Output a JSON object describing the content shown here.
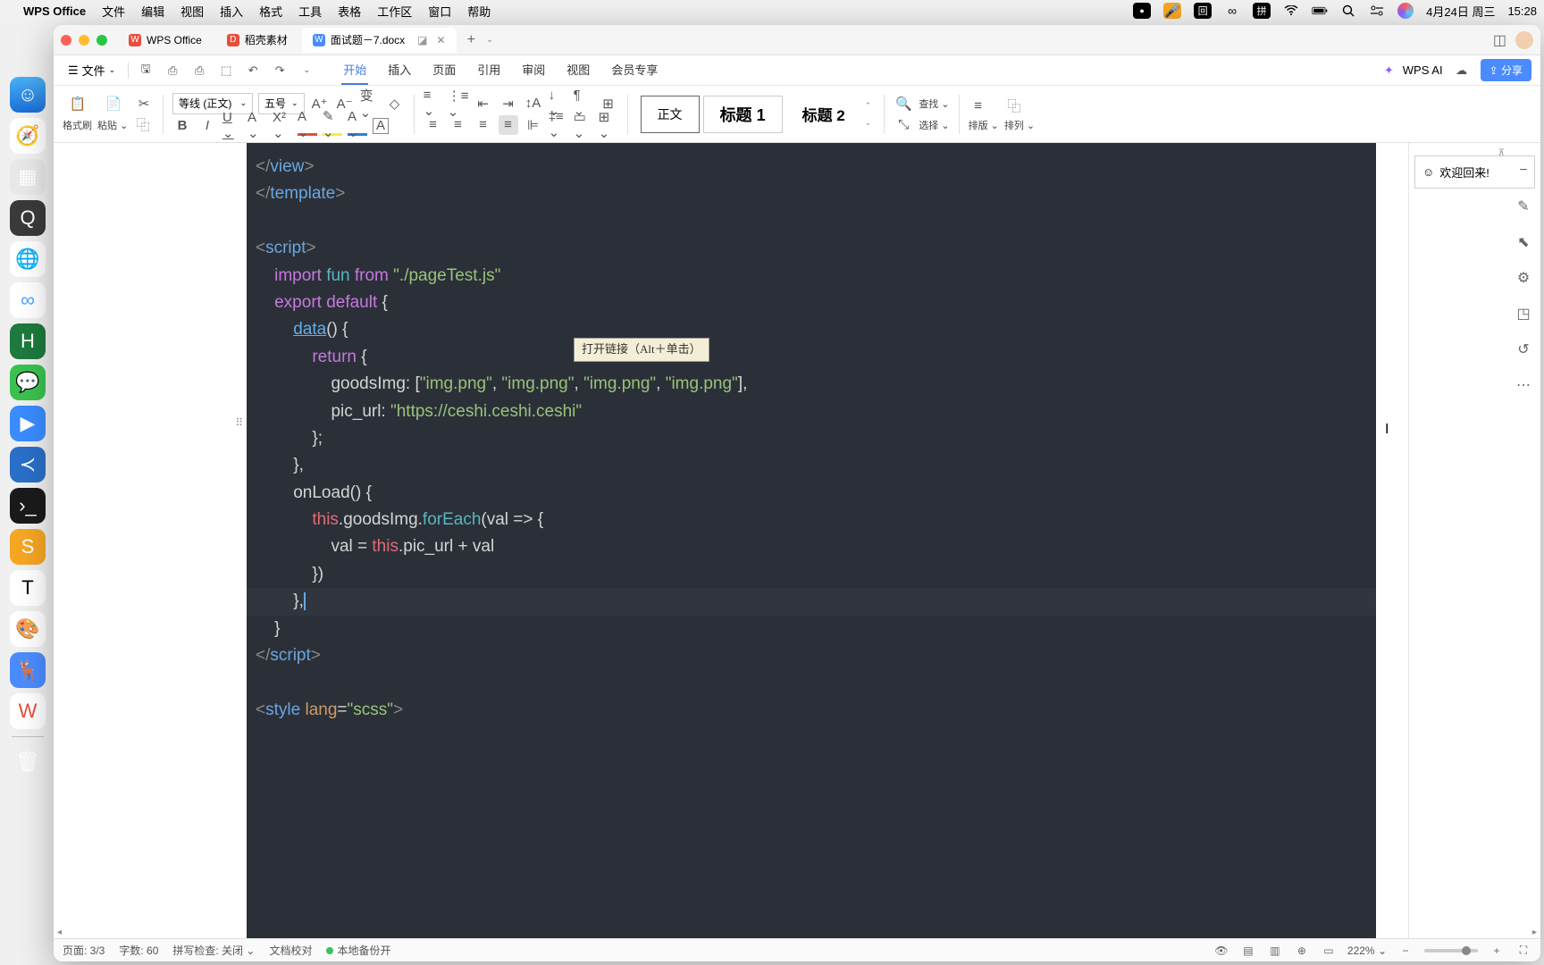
{
  "menubar": {
    "app_name": "WPS Office",
    "items": [
      "文件",
      "编辑",
      "视图",
      "插入",
      "格式",
      "工具",
      "表格",
      "工作区",
      "窗口",
      "帮助"
    ],
    "date": "4月24日 周三",
    "time": "15:28",
    "ime": "拼"
  },
  "tabs": {
    "home": "WPS Office",
    "template": "稻壳素材",
    "doc": "面试题－7.docx"
  },
  "menu_row": {
    "file_label": "文件",
    "tabs": [
      "开始",
      "插入",
      "页面",
      "引用",
      "审阅",
      "视图",
      "会员专享"
    ],
    "ai_label": "WPS AI",
    "share_label": "分享"
  },
  "ribbon": {
    "format_painter": "格式刷",
    "paste": "粘贴",
    "font_name": "等线 (正文)",
    "font_size": "五号",
    "style_body": "正文",
    "style_h1": "标题 1",
    "style_h2": "标题 2",
    "find": "查找",
    "select": "选择",
    "arrange": "排版",
    "arrange2": "排列"
  },
  "sidebar": {
    "welcome": "欢迎回来!"
  },
  "code": {
    "l1": "        </view>",
    "l2": "</template>",
    "l3": "",
    "l4": "<script>",
    "l5_a": "    import ",
    "l5_b": "fun",
    "l5_c": " from ",
    "l5_d": "\"./pageTest.js\"",
    "l6_a": "    export ",
    "l6_b": "default",
    "l6_c": " {",
    "l7_a": "        ",
    "l7_b": "data",
    "l7_c": "() {",
    "l8_a": "            return",
    "l8_b": " {",
    "l9_a": "                goodsImg: [",
    "l9_b": "\"img.png\"",
    "l9_c": ", ",
    "l9_d": "\"img.png\"",
    "l9_e": ", ",
    "l9_f": "\"img.png\"",
    "l9_g": ", ",
    "l9_h": "\"img.png\"",
    "l9_i": "],",
    "l10_a": "                pic_url: ",
    "l10_b": "\"https://ceshi.ceshi.ceshi\"",
    "l11": "            };",
    "l12": "        },",
    "l13": "        onLoad() {",
    "l14_a": "            this",
    "l14_b": ".goodsImg.",
    "l14_c": "forEach",
    "l14_d": "(val => {",
    "l15_a": "                val = ",
    "l15_b": "this",
    "l15_c": ".pic_url + val",
    "l16": "            })",
    "l17": "        },",
    "l18": "    }",
    "l19": "</script>",
    "l20": "",
    "l21_a": "<",
    "l21_b": "style",
    "l21_c": " lang",
    "l21_d": "=",
    "l21_e": "\"scss\"",
    "l21_f": ">",
    "tooltip": "打开链接（Alt＋单击）"
  },
  "status": {
    "page": "页面: 3/3",
    "words": "字数: 60",
    "spell": "拼写检查: 关闭",
    "proof": "文档校对",
    "backup": "本地备份开",
    "zoom": "222%"
  }
}
